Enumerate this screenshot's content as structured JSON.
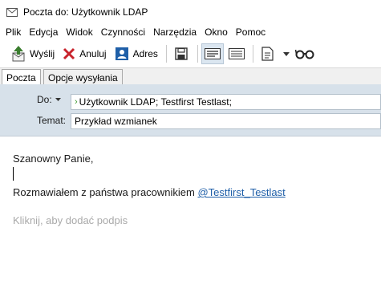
{
  "window": {
    "title": "Poczta do: Użytkownik LDAP",
    "icon": "envelope-icon"
  },
  "menu": [
    "Plik",
    "Edycja",
    "Widok",
    "Czynności",
    "Narzędzia",
    "Okno",
    "Pomoc"
  ],
  "toolbar": {
    "send_label": "Wyślij",
    "cancel_label": "Anuluj",
    "address_label": "Adres"
  },
  "tabs": [
    "Poczta",
    "Opcje wysyłania"
  ],
  "header": {
    "to_label": "Do:",
    "to_value": "Użytkownik LDAP;  Testfirst Testlast;",
    "subject_label": "Temat:",
    "subject_value": "Przykład wzmianek"
  },
  "body": {
    "greeting": "Szanowny Panie,",
    "message_prefix": "Rozmawiałem z państwa pracownikiem ",
    "mention": "@Testfirst_Testlast",
    "signature_placeholder": "Kliknij, aby dodać podpis"
  },
  "colors": {
    "header_bg": "#d7e1ea",
    "mention": "#1f5fa8",
    "placeholder": "#a9a9a9",
    "send_icon": "#3a7d2e",
    "cancel_icon": "#c8232c"
  }
}
